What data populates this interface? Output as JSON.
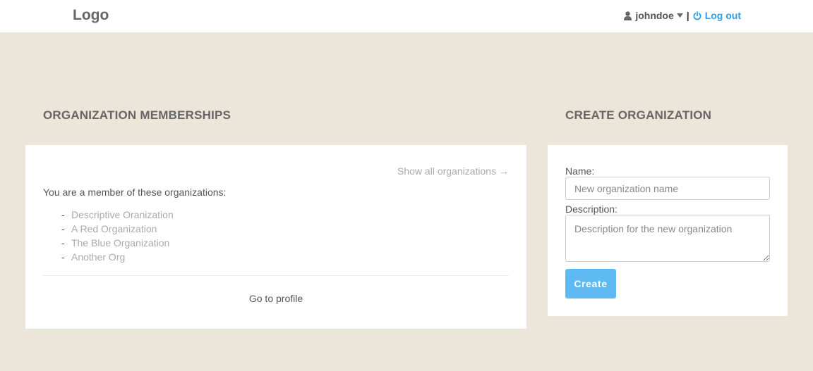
{
  "header": {
    "logo": "Logo",
    "username": "johndoe",
    "separator": "|",
    "logout_label": "Log out",
    "link_color": "#2d9ee8"
  },
  "memberships": {
    "title": "ORGANIZATION MEMBERSHIPS",
    "show_all_label": "Show all organizations →",
    "intro": "You are a member of these organizations:",
    "organizations": [
      "Descriptive Oranization",
      "A Red Organization",
      "The Blue Organization",
      "Another Org"
    ],
    "list_marker": "-",
    "profile_link": "Go to profile"
  },
  "create": {
    "title": "CREATE ORGANIZATION",
    "name_label": "Name:",
    "name_placeholder": "New organization name",
    "name_value": "",
    "description_label": "Description:",
    "description_placeholder": "Description for the new organization",
    "description_value": "",
    "button_label": "Create",
    "button_color": "#5fb9f3"
  },
  "icons": {
    "user": "user-icon",
    "caret": "caret-down-icon",
    "power": "power-icon"
  },
  "colors": {
    "background": "#ece5da",
    "panel": "#ffffff"
  }
}
